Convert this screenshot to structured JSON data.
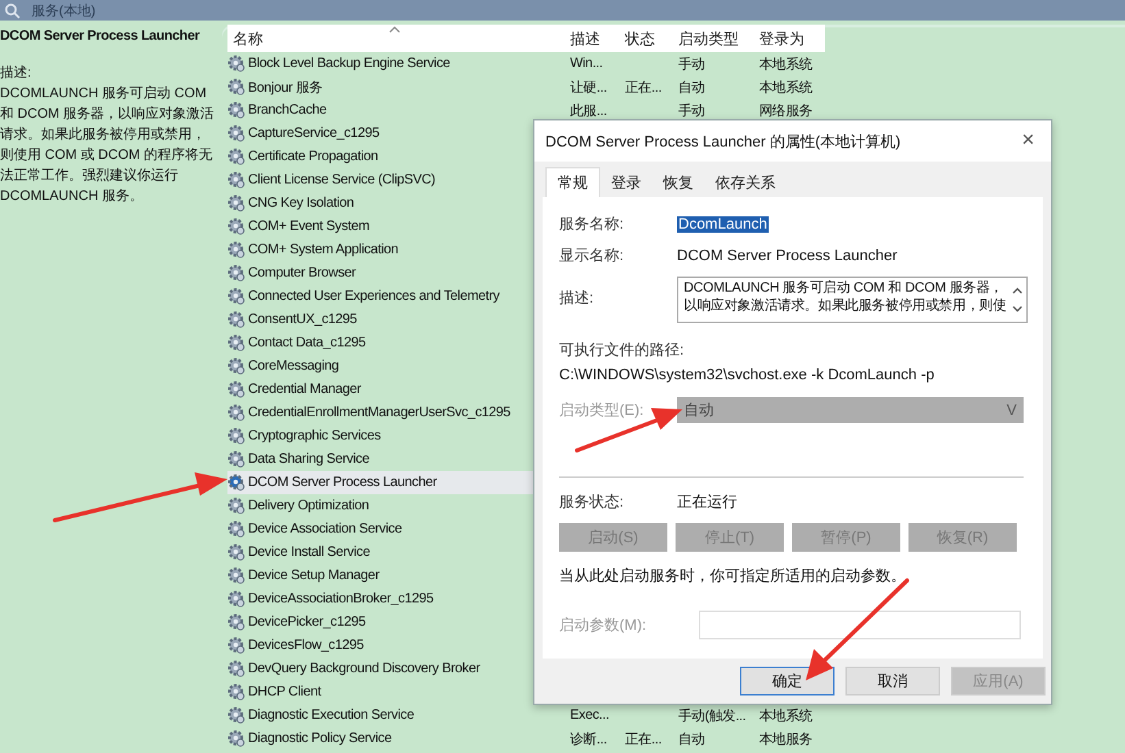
{
  "window": {
    "title": "服务(本地)"
  },
  "details": {
    "title": "DCOM Server Process Launcher",
    "description_label": "描述:",
    "description": "DCOMLAUNCH 服务可启动 COM 和 DCOM 服务器，以响应对象激活请求。如果此服务被停用或禁用，则使用 COM 或 DCOM 的程序将无法正常工作。强烈建议你运行 DCOMLAUNCH 服务。"
  },
  "table": {
    "columns": [
      "名称",
      "描述",
      "状态",
      "启动类型",
      "登录为"
    ],
    "rows": [
      {
        "name": "Block Level Backup Engine Service",
        "description": "Win...",
        "startup": "手动",
        "logon": "本地系统",
        "selected": false
      },
      {
        "name": "Bonjour 服务",
        "description": "让硬...",
        "status": "正在...",
        "startup": "自动",
        "logon": "本地系统",
        "selected": false
      },
      {
        "name": "BranchCache",
        "description": "此服...",
        "startup": "手动",
        "logon": "网络服务",
        "selected": false
      },
      {
        "name": "CaptureService_c1295",
        "selected": false
      },
      {
        "name": "Certificate Propagation",
        "selected": false
      },
      {
        "name": "Client License Service (ClipSVC)",
        "selected": false
      },
      {
        "name": "CNG Key Isolation",
        "selected": false
      },
      {
        "name": "COM+ Event System",
        "selected": false
      },
      {
        "name": "COM+ System Application",
        "selected": false
      },
      {
        "name": "Computer Browser",
        "selected": false
      },
      {
        "name": "Connected User Experiences and Telemetry",
        "selected": false
      },
      {
        "name": "ConsentUX_c1295",
        "selected": false
      },
      {
        "name": "Contact Data_c1295",
        "selected": false
      },
      {
        "name": "CoreMessaging",
        "selected": false
      },
      {
        "name": "Credential Manager",
        "selected": false
      },
      {
        "name": "CredentialEnrollmentManagerUserSvc_c1295",
        "selected": false
      },
      {
        "name": "Cryptographic Services",
        "selected": false
      },
      {
        "name": "Data Sharing Service",
        "selected": false
      },
      {
        "name": "DCOM Server Process Launcher",
        "selected": true
      },
      {
        "name": "Delivery Optimization",
        "selected": false
      },
      {
        "name": "Device Association Service",
        "selected": false
      },
      {
        "name": "Device Install Service",
        "selected": false
      },
      {
        "name": "Device Setup Manager",
        "selected": false
      },
      {
        "name": "DeviceAssociationBroker_c1295",
        "selected": false
      },
      {
        "name": "DevicePicker_c1295",
        "selected": false
      },
      {
        "name": "DevicesFlow_c1295",
        "selected": false
      },
      {
        "name": "DevQuery Background Discovery Broker",
        "selected": false
      },
      {
        "name": "DHCP Client",
        "selected": false
      },
      {
        "name": "Diagnostic Execution Service",
        "description": "Exec...",
        "startup": "手动(触发...",
        "logon": "本地系统",
        "selected": false
      },
      {
        "name": "Diagnostic Policy Service",
        "description": "诊断...",
        "status": "正在...",
        "startup": "自动",
        "logon": "本地服务",
        "selected": false
      }
    ]
  },
  "dialog": {
    "title": "DCOM Server Process Launcher 的属性(本地计算机)",
    "close": "×",
    "tabs": [
      {
        "label": "常规",
        "selected": true
      },
      {
        "label": "登录",
        "selected": false
      },
      {
        "label": "恢复",
        "selected": false
      },
      {
        "label": "依存关系",
        "selected": false
      }
    ],
    "service_name": {
      "label": "服务名称:",
      "value": "DcomLaunch"
    },
    "display_name": {
      "label": "显示名称:",
      "value": "DCOM Server Process Launcher"
    },
    "description": {
      "label": "描述:",
      "lines": [
        "DCOMLAUNCH 服务可启动 COM 和 DCOM 服务器，",
        "以响应对象激活请求。如果此服务被停用或禁用，则使"
      ]
    },
    "path": {
      "label": "可执行文件的路径:",
      "value": "C:\\WINDOWS\\system32\\svchost.exe -k DcomLaunch -p"
    },
    "startup_type": {
      "label": "启动类型(E):",
      "value": "自动",
      "chevron": "V",
      "disabled": true
    },
    "status": {
      "label": "服务状态:",
      "value": "正在运行"
    },
    "control_buttons": [
      {
        "label": "启动(S)",
        "disabled": true
      },
      {
        "label": "停止(T)",
        "disabled": true
      },
      {
        "label": "暂停(P)",
        "disabled": true
      },
      {
        "label": "恢复(R)",
        "disabled": true
      }
    ],
    "hint": "当从此处启动服务时，你可指定所适用的启动参数。",
    "parameters": {
      "label": "启动参数(M):",
      "disabled": true
    },
    "buttons": [
      {
        "label": "确定",
        "default": true,
        "disabled": false
      },
      {
        "label": "取消",
        "default": false,
        "disabled": false
      },
      {
        "label": "应用(A)",
        "default": false,
        "disabled": true
      }
    ]
  }
}
